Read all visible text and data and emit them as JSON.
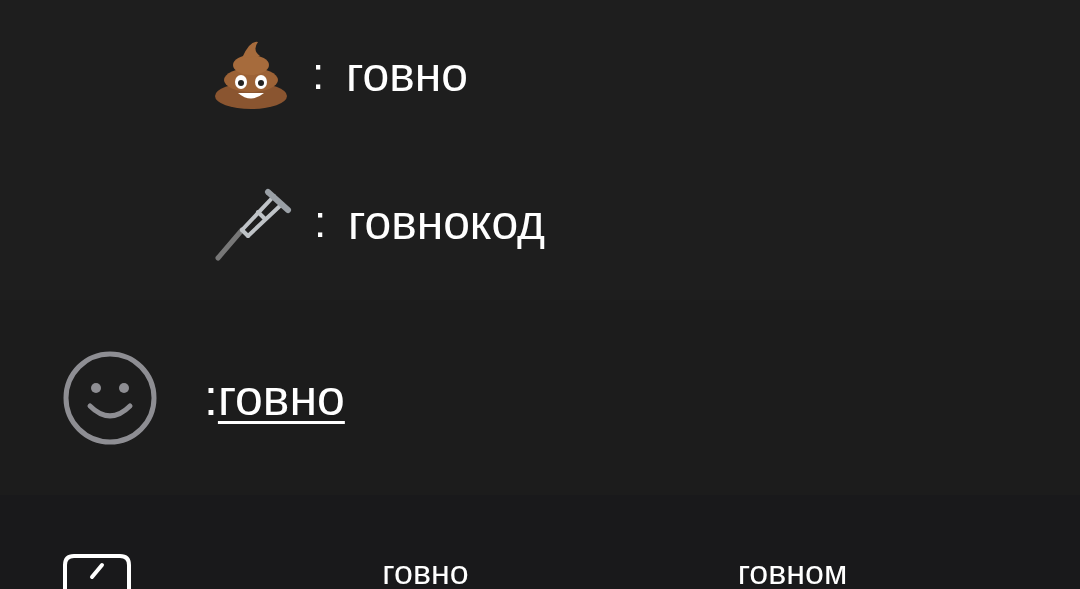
{
  "suggestions": [
    {
      "kind": "poop",
      "separator": ":",
      "label": "говно"
    },
    {
      "kind": "crutch",
      "separator": ":",
      "label": "говнокод"
    }
  ],
  "composer": {
    "trigger": ":",
    "query": "говно"
  },
  "keyboard": {
    "predictions": [
      "говно",
      "говном"
    ]
  }
}
